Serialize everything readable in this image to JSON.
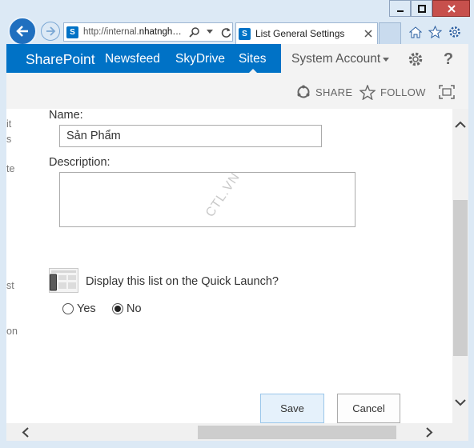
{
  "browser": {
    "url_prefix": "http://internal.",
    "url_host": "nhatngh…",
    "tab_title": "List General Settings",
    "icons": [
      "back-icon",
      "forward-icon",
      "search-icon",
      "dropdown-icon",
      "refresh-icon",
      "close-tab-icon",
      "home-icon",
      "favorites-star-icon",
      "settings-gear-icon",
      "minimize-icon",
      "maximize-icon",
      "close-window-icon"
    ]
  },
  "suite": {
    "brand": "SharePoint",
    "nav": [
      "Newsfeed",
      "SkyDrive",
      "Sites"
    ],
    "account": "System Account",
    "brand_color": "#0072c6"
  },
  "actions": {
    "share": "SHARE",
    "follow": "FOLLOW"
  },
  "leftnav": [
    "it",
    "s",
    "te",
    "st",
    "on"
  ],
  "form": {
    "name_label": "Name:",
    "name_value": "Sản Phẩm",
    "description_label": "Description:",
    "description_value": "",
    "quick_launch_label": "Display this list on the Quick Launch?",
    "yes_label": "Yes",
    "no_label": "No",
    "selected": "No"
  },
  "watermark": "CTL.VN",
  "buttons": {
    "save": "Save",
    "cancel": "Cancel"
  }
}
